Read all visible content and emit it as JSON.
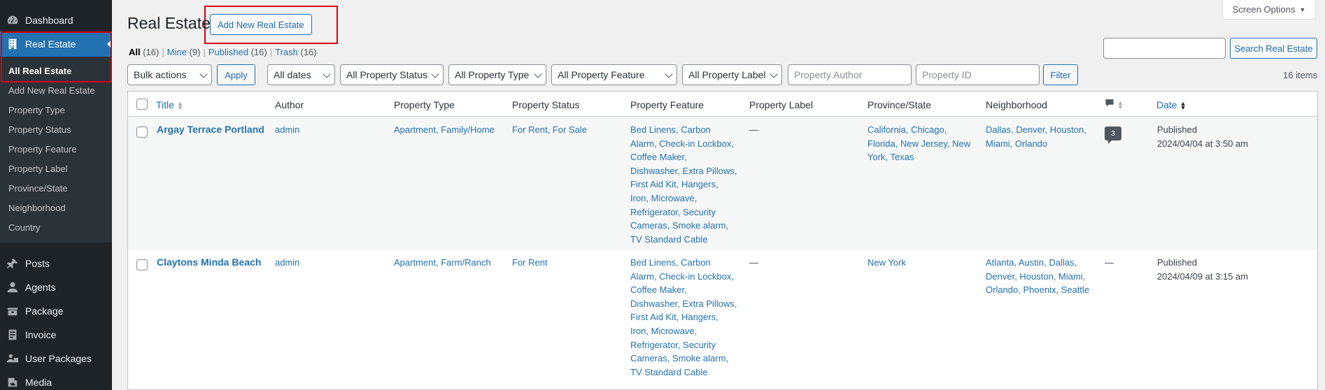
{
  "sidebar": {
    "dashboard": "Dashboard",
    "real_estate": "Real Estate",
    "submenu": [
      "All Real Estate",
      "Add New Real Estate",
      "Property Type",
      "Property Status",
      "Property Feature",
      "Property Label",
      "Province/State",
      "Neighborhood",
      "Country"
    ],
    "lower": [
      "Posts",
      "Agents",
      "Package",
      "Invoice",
      "User Packages",
      "Media"
    ]
  },
  "header": {
    "title": "Real Estate",
    "add_new": "Add New Real Estate",
    "screen_options": "Screen Options"
  },
  "views": {
    "all": "All",
    "all_count": "(16)",
    "mine": "Mine",
    "mine_count": "(9)",
    "published": "Published",
    "published_count": "(16)",
    "trash": "Trash",
    "trash_count": "(16)",
    "sep": "|"
  },
  "search": {
    "button": "Search Real Estate"
  },
  "filters": {
    "bulk_actions": "Bulk actions",
    "apply": "Apply",
    "dates": "All dates",
    "status": "All Property Status",
    "type": "All Property Type",
    "feature": "All Property Feature",
    "label": "All Property Label",
    "author_placeholder": "Property Author",
    "id_placeholder": "Property ID",
    "filter": "Filter",
    "items": "16 items"
  },
  "columns": {
    "title": "Title",
    "author": "Author",
    "type": "Property Type",
    "status": "Property Status",
    "feature": "Property Feature",
    "label": "Property Label",
    "province": "Province/State",
    "neighborhood": "Neighborhood",
    "date": "Date"
  },
  "rows": [
    {
      "title": "Argay Terrace Portland",
      "author": "admin",
      "type": "Apartment, Family/Home",
      "status": "For Rent, For Sale",
      "feature": [
        "Bed Linens, Carbon",
        "Alarm, Check-in Lockbox,",
        "Coffee Maker,",
        "Dishwasher, Extra Pillows,",
        "First Aid Kit, Hangers,",
        "Iron, Microwave,",
        "Refrigerator, Security",
        "Cameras, Smoke alarm,",
        "TV Standard Cable"
      ],
      "label": "—",
      "province": [
        "California, Chicago,",
        "Florida, New Jersey, New",
        "York, Texas"
      ],
      "neighborhood": [
        "Dallas, Denver, Houston,",
        "Miami, Orlando"
      ],
      "comments": "3",
      "date_status": "Published",
      "date": "2024/04/04 at 3:50 am"
    },
    {
      "title": "Claytons Minda Beach",
      "author": "admin",
      "type": "Apartment, Farm/Ranch",
      "status": "For Rent",
      "feature": [
        "Bed Linens, Carbon",
        "Alarm, Check-in Lockbox,",
        "Coffee Maker,",
        "Dishwasher, Extra Pillows,",
        "First Aid Kit, Hangers,",
        "Iron, Microwave,",
        "Refrigerator, Security",
        "Cameras, Smoke alarm,",
        "TV Standard Cable"
      ],
      "label": "—",
      "province": [
        "New York"
      ],
      "neighborhood": [
        "Atlanta, Austin, Dallas,",
        "Denver, Houston, Miami,",
        "Orlando, Phoenix, Seattle"
      ],
      "comments": "—",
      "date_status": "Published",
      "date": "2024/04/09 at 3:15 am"
    }
  ],
  "colors": {
    "accent": "#2271b1",
    "sidebar": "#1d2327",
    "highlight": "#d9000f"
  }
}
